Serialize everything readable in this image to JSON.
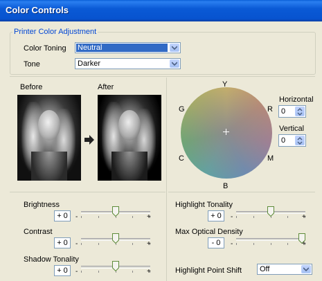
{
  "window": {
    "title": "Color Controls"
  },
  "printer_group": {
    "legend": "Printer Color Adjustment",
    "color_toning": {
      "label": "Color Toning",
      "value": "Neutral"
    },
    "tone": {
      "label": "Tone",
      "value": "Darker"
    }
  },
  "preview": {
    "before_label": "Before",
    "after_label": "After"
  },
  "color_wheel": {
    "labels": {
      "y": "Y",
      "r": "R",
      "g": "G",
      "c": "C",
      "m": "M",
      "b": "B"
    },
    "horizontal": {
      "label": "Horizontal",
      "value": "0"
    },
    "vertical": {
      "label": "Vertical",
      "value": "0"
    }
  },
  "adjustments": {
    "brightness": {
      "label": "Brightness",
      "value": "+ 0",
      "fraction": 0.5
    },
    "contrast": {
      "label": "Contrast",
      "value": "+ 0",
      "fraction": 0.5
    },
    "shadow_tonality": {
      "label": "Shadow Tonality",
      "value": "+ 0",
      "fraction": 0.5
    },
    "highlight_tonality": {
      "label": "Highlight Tonality",
      "value": "+ 0",
      "fraction": 0.5
    },
    "max_optical_density": {
      "label": "Max Optical Density",
      "value": "- 0",
      "fraction": 1.0
    },
    "highlight_point_shift": {
      "label": "Highlight Point Shift",
      "value": "Off"
    }
  },
  "slider_signs": {
    "minus": "-",
    "plus": "+"
  }
}
